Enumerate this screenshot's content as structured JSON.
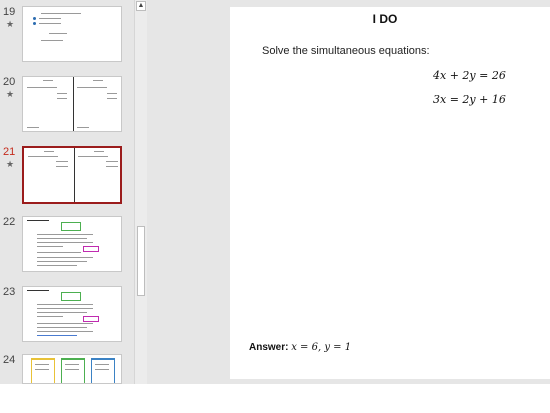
{
  "thumbnails": [
    {
      "number": "19",
      "starred": true
    },
    {
      "number": "20",
      "starred": true
    },
    {
      "number": "21",
      "starred": true,
      "active": true
    },
    {
      "number": "22",
      "starred": false
    },
    {
      "number": "23",
      "starred": false
    },
    {
      "number": "24",
      "starred": false
    }
  ],
  "star_glyph": "★",
  "scroll_up_glyph": "▲",
  "slide": {
    "title": "I DO",
    "prompt": "Solve the simultaneous equations:",
    "equation_1": "4x + 2y = 26",
    "equation_2": "3x = 2y + 16",
    "answer_label": "Answer:",
    "answer_value": "x = 6, y = 1"
  },
  "colors": {
    "active_border": "#9b1c1c",
    "active_number": "#c42b1c",
    "pane_background": "#e6e6e6"
  }
}
